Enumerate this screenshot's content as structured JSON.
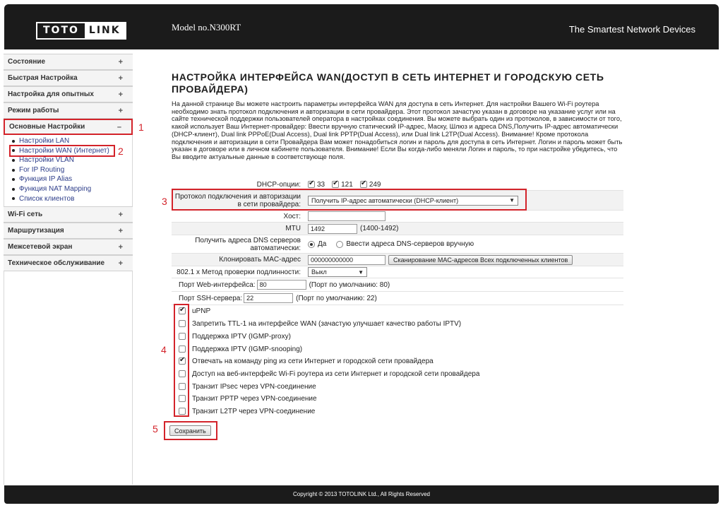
{
  "header": {
    "logo_left": "TOTO",
    "logo_right": "LINK",
    "model": "Model no.N300RT",
    "tagline": "The Smartest Network Devices"
  },
  "sidebar": {
    "items": [
      {
        "label": "Состояние",
        "sign": "+"
      },
      {
        "label": "Быстрая Настройка",
        "sign": "+"
      },
      {
        "label": "Настройка для опытных",
        "sign": "+"
      },
      {
        "label": "Режим работы",
        "sign": "+"
      },
      {
        "label": "Основные Настройки",
        "sign": "–"
      },
      {
        "label": "Wi-Fi сеть",
        "sign": "+"
      },
      {
        "label": "Маршрутизация",
        "sign": "+"
      },
      {
        "label": "Межсетевой экран",
        "sign": "+"
      },
      {
        "label": "Техническое обслуживание",
        "sign": "+"
      }
    ],
    "submenu": [
      "Настройки LAN",
      "Настройки WAN (Интернет)",
      "Настройки VLAN",
      "For IP Routing",
      "Функция IP Alias",
      "Функция NAT Mapping",
      "Список клиентов"
    ]
  },
  "annotations": [
    "1",
    "2",
    "3",
    "4",
    "5"
  ],
  "page": {
    "title": "НАСТРОЙКА ИНТЕРФЕЙСА WAN(ДОСТУП В СЕТЬ ИНТЕРНЕТ И ГОРОДСКУЮ СЕТЬ ПРОВАЙДЕРА)",
    "description": "На данной странице Вы можете настроить параметры интерфейса WAN для доступа в сеть Интернет. Для настройки Вашего Wi-Fi роутера необходимо знать протокол подключения и авторизации в сети провайдера. Этот протокол зачастую указан в договоре на указание услуг или на сайте технической поддержки пользователей оператора в настройках соединения. Вы можете выбрать один из протоколов, в зависимости от того, какой использует Ваш Интернет-провайдер: Ввести вручную статический IP-адрес, Маску, Шлюз и адреса DNS,Получить IP-адрес автоматически (DHCP-клиент), Dual link PPPoE(Dual Access), Dual link PPTP(Dual Access), или Dual link L2TP(Dual Access). Внимание! Кроме протокола подключения и авторизации в сети Провайдера Вам может понадобиться логин и пароль для доступа в сеть Интернет. Логин и пароль может быть указан в договоре или в личном кабинете пользователя. Внимание! Если Вы когда-либо меняли Логин и пароль, то при настройке убедитесь, что Вы вводите актуальные данные в соответствующе поля."
  },
  "form": {
    "dhcp_label": "DHCP-опции:",
    "dhcp_options": [
      "33",
      "121",
      "249"
    ],
    "protocol_label": "Протокол подключения и авторизации в сети провайдера:",
    "protocol_value": "Получить IP-адрес автоматически (DHCP-клиент)",
    "host_label": "Хост:",
    "host_value": "",
    "mtu_label": "MTU",
    "mtu_value": "1492",
    "mtu_hint": "(1400-1492)",
    "dns_label": "Получить адреса DNS серверов автоматически:",
    "dns_yes": "Да",
    "dns_manual": "Ввести адреса DNS-серверов вручную",
    "mac_label": "Клонировать MAC-адрес",
    "mac_value": "000000000000",
    "mac_button": "Сканирование MAC-адресов Всех подключенных клиентов",
    "auth_label": "802.1 x Метод проверки подлинности:",
    "auth_value": "Выкл",
    "web_port_label": "Порт Web-интерфейса:",
    "web_port_value": "80",
    "web_port_hint": "(Порт по умолчанию: 80)",
    "ssh_port_label": "Порт SSH-сервера:",
    "ssh_port_value": "22",
    "ssh_port_hint": "(Порт по умолчанию: 22)",
    "options": [
      {
        "label": "uPNP",
        "checked": true
      },
      {
        "label": "Запретить TTL-1 на интерфейсе WAN (зачастую улучшает качество работы IPTV)",
        "checked": false
      },
      {
        "label": "Поддержка IPTV (IGMP-proxy)",
        "checked": false
      },
      {
        "label": "Поддержка IPTV (IGMP-snooping)",
        "checked": false
      },
      {
        "label": "Отвечать на команду ping из сети Интернет и городской сети провайдера",
        "checked": true
      },
      {
        "label": "Доступ на веб-интерфейс Wi-Fi роутера из сети Интернет и городской сети провайдера",
        "checked": false
      },
      {
        "label": "Транзит IPsec через VPN-соединение",
        "checked": false
      },
      {
        "label": "Транзит PPTP через VPN-соединение",
        "checked": false
      },
      {
        "label": "Транзит L2TP через VPN-соединение",
        "checked": false
      }
    ],
    "save_label": "Сохранить"
  },
  "footer": {
    "copyright": "Copyright © 2013 TOTOLINK Ltd.,   All Rights Reserved"
  },
  "colors": {
    "header_bg": "#1b1b1b",
    "annotation_red": "#d3232a",
    "link_blue": "#2e3e8a"
  }
}
